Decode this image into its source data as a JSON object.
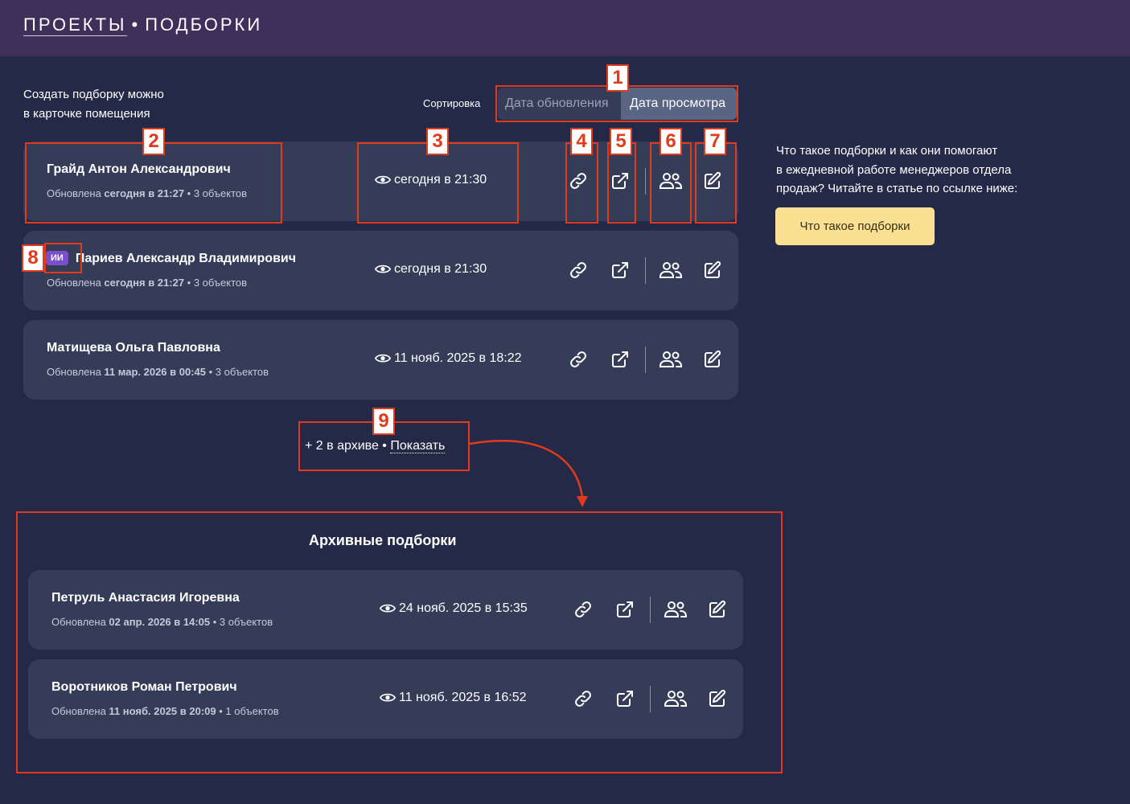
{
  "header": {
    "breadcrumb_link": "ПРОЕКТЫ",
    "separator": "•",
    "breadcrumb_current": "ПОДБОРКИ"
  },
  "hint": {
    "line1": "Создать подборку можно",
    "line2": "в карточке помещения"
  },
  "sort": {
    "label": "Сортировка",
    "options": [
      "Дата обновления",
      "Дата просмотра"
    ],
    "selected": "Дата просмотра"
  },
  "collections": [
    {
      "name": "Грайд Антон Александрович",
      "updated_prefix": "Обновлена",
      "updated_date": "сегодня в 21:27",
      "count": "• 3 объектов",
      "viewed": "сегодня в 21:30",
      "ai": false
    },
    {
      "name": "Париев Александр Владимирович",
      "updated_prefix": "Обновлена",
      "updated_date": "сегодня в 21:27",
      "count": "• 3 объектов",
      "viewed": "сегодня в 21:30",
      "ai": true,
      "ai_badge": "ИИ"
    },
    {
      "name": "Матищева Ольга Павловна",
      "updated_prefix": "Обновлена",
      "updated_date": "11 мар. 2026 в 00:45",
      "count": "• 3 объектов",
      "viewed": "11 нояб. 2025 в 18:22",
      "ai": false
    }
  ],
  "archive_toggle": {
    "text": "+ 2 в архиве •",
    "show_label": "Показать"
  },
  "archive": {
    "title": "Архивные подборки",
    "items": [
      {
        "name": "Петруль Анастасия Игоревна",
        "updated_prefix": "Обновлена",
        "updated_date": "02 апр. 2026 в 14:05",
        "count": "• 3 объектов",
        "viewed": "24 нояб. 2025 в 15:35"
      },
      {
        "name": "Воротников Роман Петрович",
        "updated_prefix": "Обновлена",
        "updated_date": "11 нояб. 2025 в 20:09",
        "count": "• 1 объектов",
        "viewed": "11 нояб. 2025 в 16:52"
      }
    ]
  },
  "sidebar": {
    "line1": "Что такое подборки и как они помогают",
    "line2": "в ежедневной работе менеджеров отдела",
    "line3": "продаж? Читайте в статье по ссылке ниже:",
    "button_label": "Что такое подборки"
  },
  "icons": {
    "view": "eye-icon",
    "copy_link": "link-icon",
    "open": "external-link-icon",
    "share": "users-icon",
    "edit": "edit-icon"
  },
  "annotations": [
    "1",
    "2",
    "3",
    "4",
    "5",
    "6",
    "7",
    "8",
    "9"
  ],
  "colors": {
    "background": "#232946",
    "header": "#3f2f5b",
    "card": "#343c58",
    "sort_active": "#5a6483",
    "ai_badge": "#7a4fc9",
    "cta_button": "#fbdf93",
    "annotation": "#e13a1c"
  }
}
